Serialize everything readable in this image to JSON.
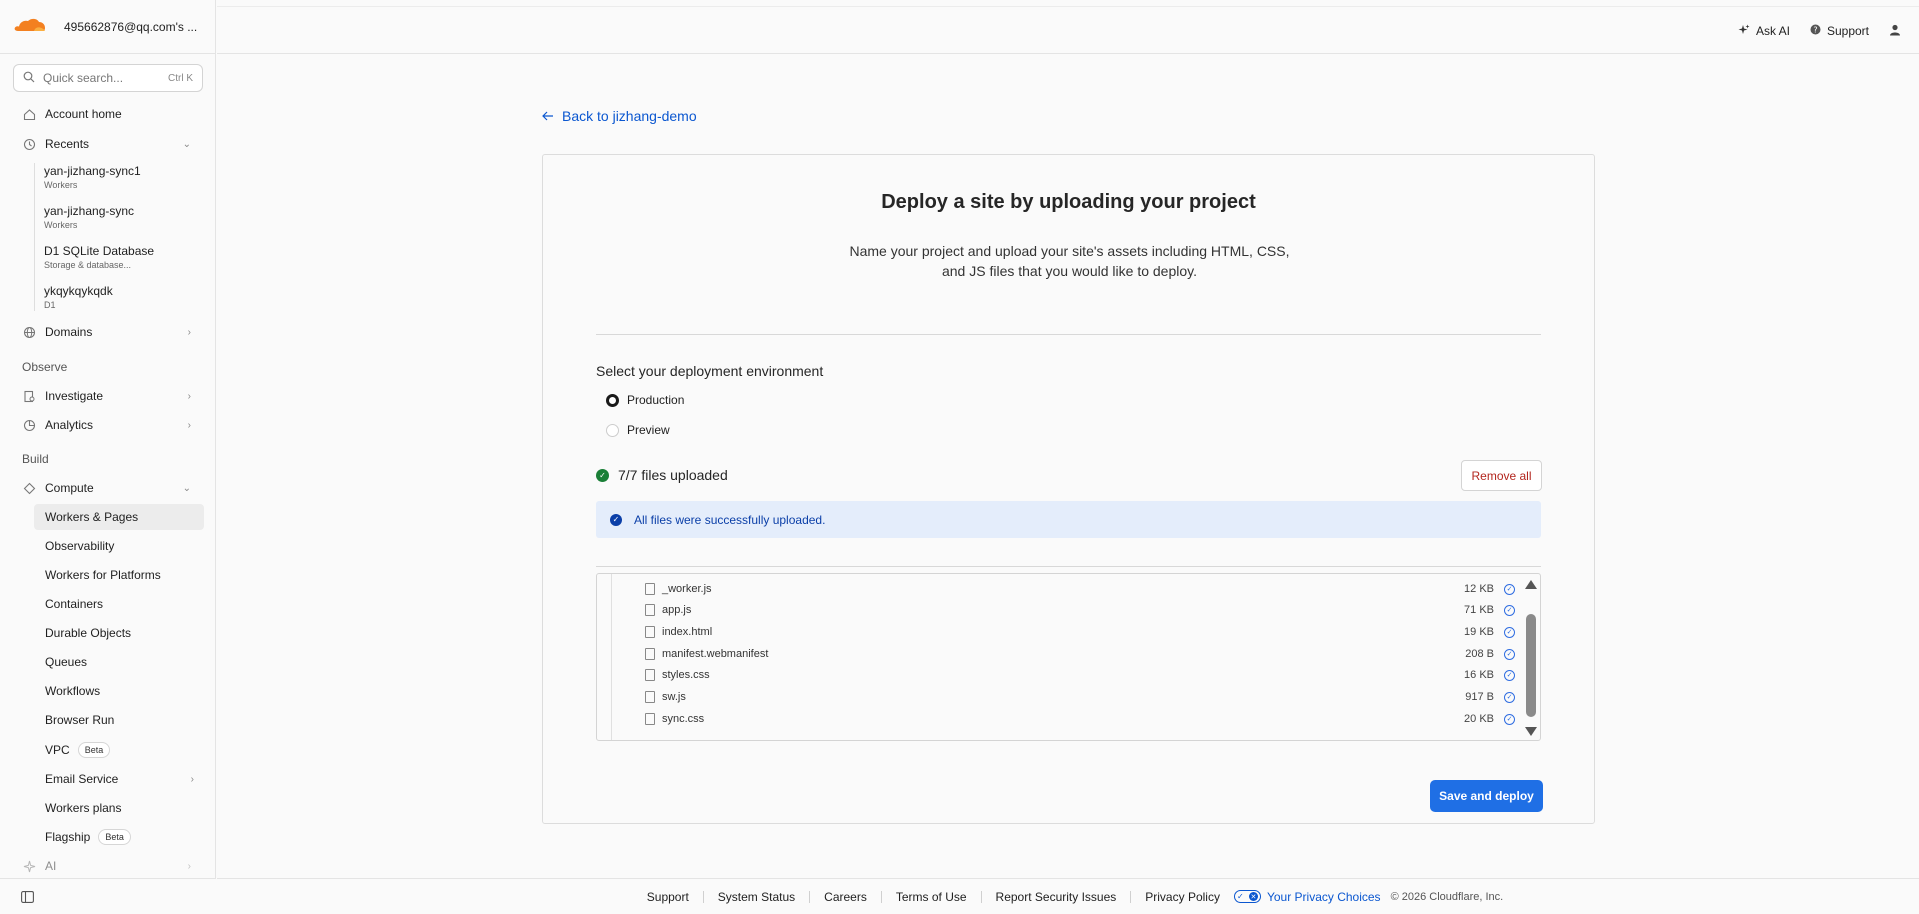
{
  "account": {
    "email": "495662876@qq.com's ..."
  },
  "search": {
    "placeholder": "Quick search...",
    "shortcut": "Ctrl K"
  },
  "sidebar": {
    "account_home": "Account home",
    "recents_label": "Recents",
    "recents": [
      {
        "title": "yan-jizhang-sync1",
        "sub": "Workers"
      },
      {
        "title": "yan-jizhang-sync",
        "sub": "Workers"
      },
      {
        "title": "D1 SQLite Database",
        "sub": "Storage & database..."
      },
      {
        "title": "ykqykqykqdk",
        "sub": "D1"
      }
    ],
    "domains": "Domains",
    "observe_label": "Observe",
    "investigate": "Investigate",
    "analytics": "Analytics",
    "build_label": "Build",
    "compute": "Compute",
    "compute_items": [
      {
        "label": "Workers & Pages",
        "badge": ""
      },
      {
        "label": "Observability",
        "badge": ""
      },
      {
        "label": "Workers for Platforms",
        "badge": ""
      },
      {
        "label": "Containers",
        "badge": ""
      },
      {
        "label": "Durable Objects",
        "badge": ""
      },
      {
        "label": "Queues",
        "badge": ""
      },
      {
        "label": "Workflows",
        "badge": ""
      },
      {
        "label": "Browser Run",
        "badge": ""
      },
      {
        "label": "VPC",
        "badge": "Beta"
      },
      {
        "label": "Email Service",
        "badge": ""
      },
      {
        "label": "Workers plans",
        "badge": ""
      },
      {
        "label": "Flagship",
        "badge": "Beta"
      }
    ],
    "ai": "AI"
  },
  "topbar": {
    "ask_ai": "Ask AI",
    "support": "Support"
  },
  "main": {
    "back_link": "Back to jizhang-demo",
    "title": "Deploy a site by uploading your project",
    "description": "Name your project and upload your site's assets including HTML, CSS, and JS files that you would like to deploy.",
    "env_label": "Select your deployment environment",
    "env_options": [
      "Production",
      "Preview"
    ],
    "env_selected": "Production",
    "uploaded_status": "7/7 files uploaded",
    "remove_all": "Remove all",
    "banner": "All files were successfully uploaded.",
    "files": [
      {
        "name": "_worker.js",
        "size": "12 KB"
      },
      {
        "name": "app.js",
        "size": "71 KB"
      },
      {
        "name": "index.html",
        "size": "19 KB"
      },
      {
        "name": "manifest.webmanifest",
        "size": "208 B"
      },
      {
        "name": "styles.css",
        "size": "16 KB"
      },
      {
        "name": "sw.js",
        "size": "917 B"
      },
      {
        "name": "sync.css",
        "size": "20 KB"
      }
    ],
    "deploy_button": "Save and deploy"
  },
  "footer": {
    "links": [
      "Support",
      "System Status",
      "Careers",
      "Terms of Use",
      "Report Security Issues",
      "Privacy Policy"
    ],
    "privacy_choices": "Your Privacy Choices",
    "copyright": "© 2026 Cloudflare, Inc."
  },
  "colors": {
    "brand": "#f38020",
    "accent": "#1f6fe5",
    "link": "#0b57d0",
    "success": "#1a7f37",
    "danger": "#b3261e"
  }
}
